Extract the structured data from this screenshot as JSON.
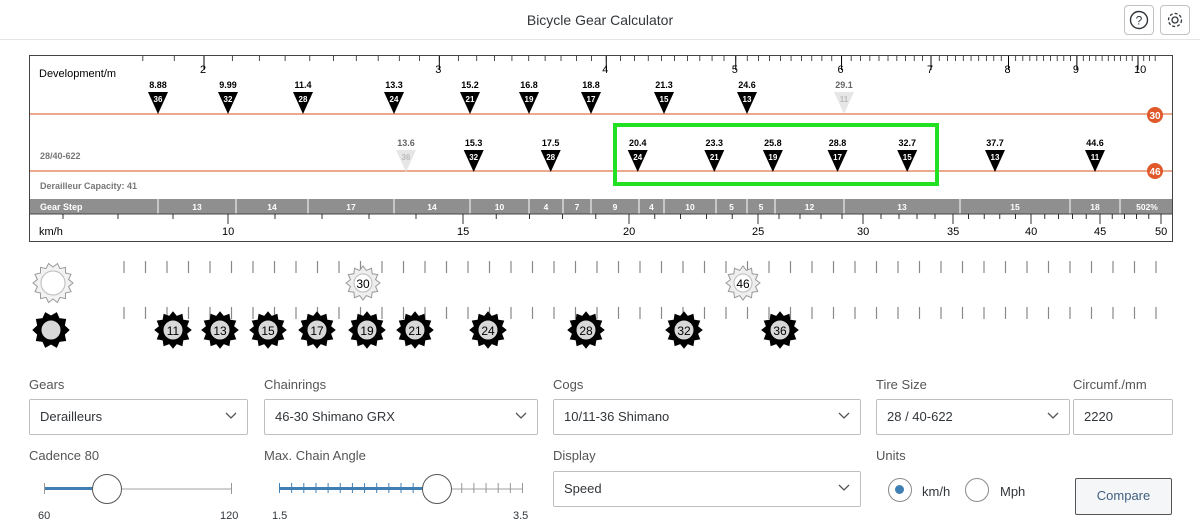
{
  "title": "Bicycle Gear Calculator",
  "header_icons": [
    "help-icon",
    "settings-gear-icon"
  ],
  "chart_data": {
    "type": "gear-development-chart",
    "development_axis": {
      "label": "Development/m",
      "tick_labels": [
        "2",
        "3",
        "4",
        "5",
        "6",
        "7",
        "8",
        "9",
        "10"
      ]
    },
    "chainring_small": {
      "teeth": "30",
      "color": "#e0592b",
      "cogs": [
        {
          "dev": "8.88",
          "cog": "36"
        },
        {
          "dev": "9.99",
          "cog": "32"
        },
        {
          "dev": "11.4",
          "cog": "28"
        },
        {
          "dev": "13.3",
          "cog": "24"
        },
        {
          "dev": "15.2",
          "cog": "21"
        },
        {
          "dev": "16.8",
          "cog": "19"
        },
        {
          "dev": "18.8",
          "cog": "17"
        },
        {
          "dev": "21.3",
          "cog": "15"
        },
        {
          "dev": "24.6",
          "cog": "13"
        },
        {
          "dev": "29.1",
          "cog": "11",
          "faded": true
        }
      ]
    },
    "chainring_large": {
      "teeth": "46",
      "color": "#e0592b",
      "cogs": [
        {
          "dev": "13.6",
          "cog": "36",
          "faded": true
        },
        {
          "dev": "15.3",
          "cog": "32"
        },
        {
          "dev": "17.5",
          "cog": "28"
        },
        {
          "dev": "20.4",
          "cog": "24"
        },
        {
          "dev": "23.3",
          "cog": "21"
        },
        {
          "dev": "25.8",
          "cog": "19"
        },
        {
          "dev": "28.8",
          "cog": "17"
        },
        {
          "dev": "32.7",
          "cog": "15"
        },
        {
          "dev": "37.7",
          "cog": "13"
        },
        {
          "dev": "44.6",
          "cog": "11"
        }
      ]
    },
    "tire_label": "28/40-622",
    "derailleur_capacity": "Derailleur Capacity: 41",
    "gear_step_label": "Gear Step",
    "gear_steps": [
      "13",
      "14",
      "17",
      "14",
      "10",
      "4",
      "7",
      "9",
      "4",
      "10",
      "5",
      "5",
      "12",
      "13",
      "15",
      "18",
      "502%"
    ],
    "speed_axis": {
      "label": "km/h",
      "tick_labels": [
        "10",
        "15",
        "20",
        "25",
        "30",
        "35",
        "40",
        "45",
        "50"
      ]
    }
  },
  "drivetrain": {
    "chainrings": [
      "30",
      "46"
    ],
    "cogs": [
      "11",
      "13",
      "15",
      "17",
      "19",
      "21",
      "24",
      "28",
      "32",
      "36"
    ]
  },
  "form": {
    "gears_label": "Gears",
    "gears_value": "Derailleurs",
    "chainrings_label": "Chainrings",
    "chainrings_value": "46-30 Shimano GRX",
    "cogs_label": "Cogs",
    "cogs_value": "10/11-36 Shimano",
    "tire_label": "Tire Size",
    "tire_value": "28 / 40-622",
    "circumf_label": "Circumf./mm",
    "circumf_value": "2220",
    "cadence_label": "Cadence 80",
    "cadence_min": "60",
    "cadence_max": "120",
    "cadence_value": 80,
    "chain_label": "Max. Chain Angle",
    "chain_min": "1.5",
    "chain_max": "3.5",
    "chain_value": 2.8,
    "display_label": "Display",
    "display_value": "Speed",
    "units_label": "Units",
    "unit_kmh": "km/h",
    "unit_mph": "Mph",
    "unit_selected": "km/h",
    "compare_label": "Compare"
  }
}
